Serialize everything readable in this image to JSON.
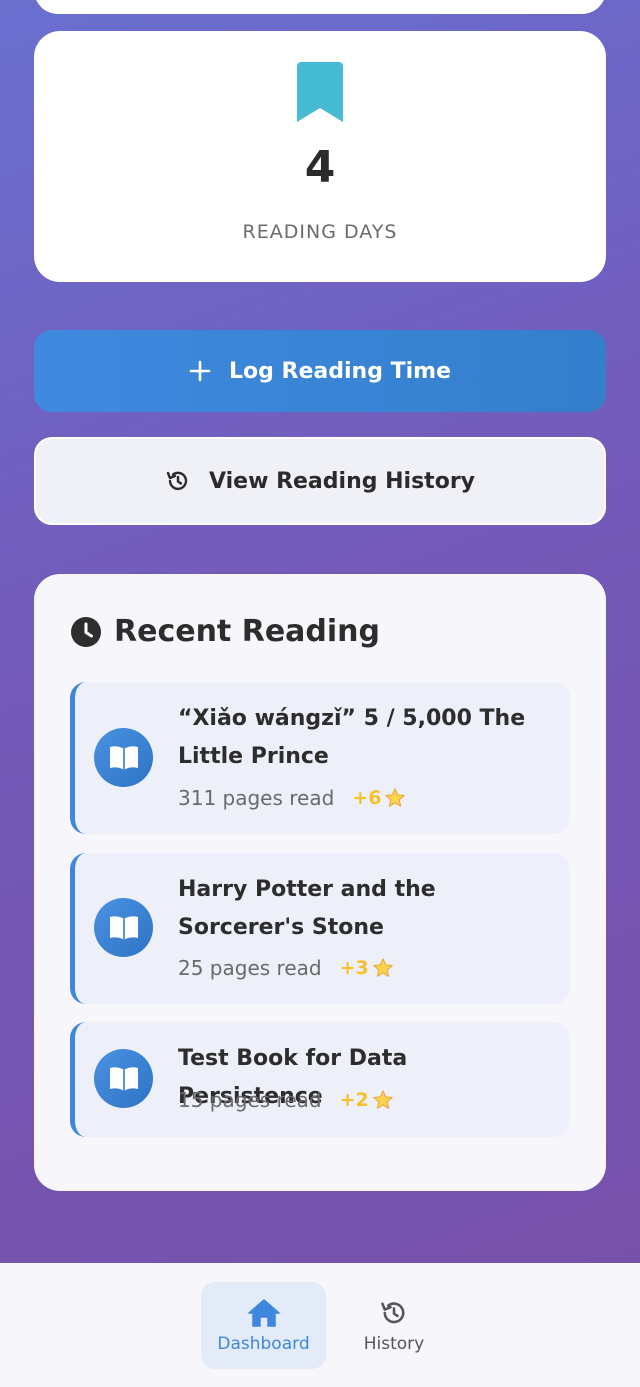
{
  "stat_card": {
    "icon": "bookmark-icon",
    "value": "4",
    "label": "READING DAYS"
  },
  "actions": {
    "log_label": "Log Reading Time",
    "log_icon": "plus-icon",
    "history_label": "View Reading History",
    "history_icon": "history-icon"
  },
  "recent": {
    "title": "Recent Reading",
    "icon": "clock-icon",
    "entries": [
      {
        "title": "“Xiǎo wángzǐ” 5 / 5,000 The Little Prince",
        "pages": "311 pages read",
        "points": "+6"
      },
      {
        "title": "Harry Potter and the Sorcerer's Stone",
        "pages": "25 pages read",
        "points": "+3"
      },
      {
        "title": "Test Book for Data Persistence",
        "pages": "15 pages read",
        "points": "+2"
      }
    ]
  },
  "nav": {
    "dashboard_label": "Dashboard",
    "history_label": "History"
  },
  "colors": {
    "accent": "#3f87dc",
    "bookmark": "#45bcd3",
    "points": "#f5c12b"
  }
}
